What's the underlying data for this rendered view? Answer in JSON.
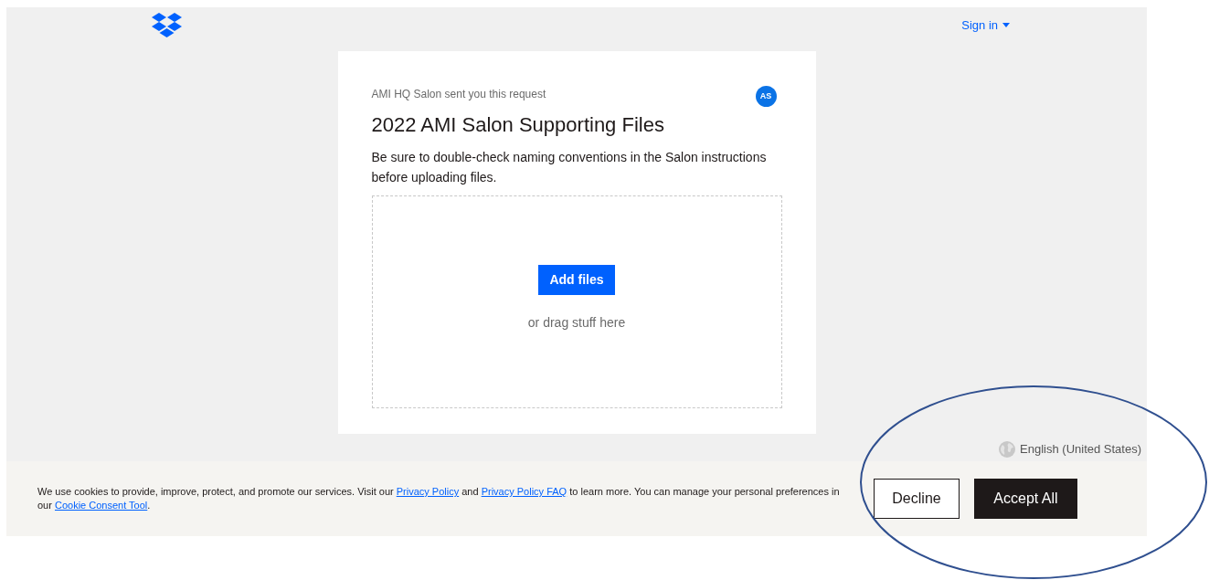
{
  "header": {
    "sign_in": "Sign in"
  },
  "request": {
    "sender_line": "AMI HQ Salon sent you this request",
    "avatar_initials": "AS",
    "title": "2022 AMI Salon Supporting Files",
    "description": "Be sure to double-check naming conventions in the Salon instructions before uploading files."
  },
  "dropzone": {
    "button": "Add files",
    "hint": "or drag stuff here"
  },
  "language": "English (United States)",
  "cookie_banner": {
    "parts": [
      {
        "kind": "text",
        "text": "We use cookies to provide, improve, protect, and promote our services. Visit our "
      },
      {
        "kind": "link",
        "text": "Privacy Policy"
      },
      {
        "kind": "text",
        "text": " and "
      },
      {
        "kind": "link",
        "text": "Privacy Policy FAQ"
      },
      {
        "kind": "text",
        "text": " to learn more. You can manage your personal preferences in our "
      },
      {
        "kind": "link",
        "text": "Cookie Consent Tool"
      },
      {
        "kind": "text",
        "text": "."
      }
    ],
    "buttons": [
      {
        "label": "Decline",
        "kind": "outline"
      },
      {
        "label": "Accept All",
        "kind": "solid"
      }
    ]
  }
}
